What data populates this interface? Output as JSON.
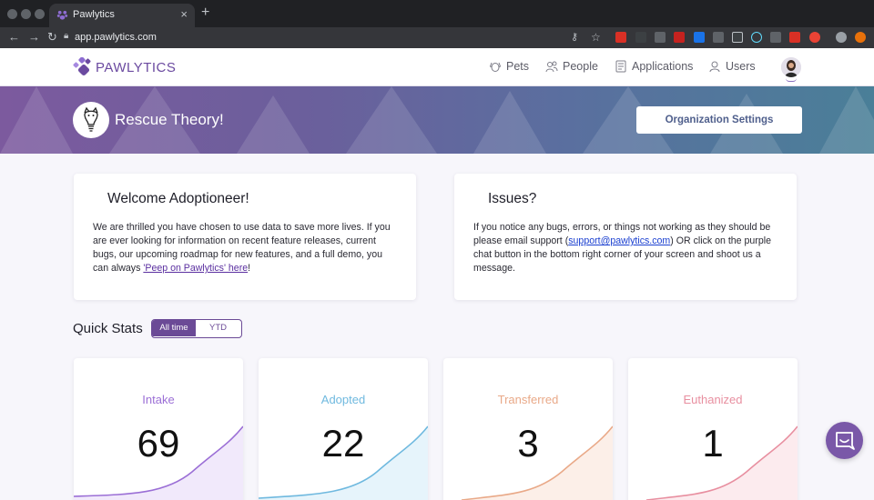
{
  "browser": {
    "tab_title": "Pawlytics",
    "tab_close": "×",
    "new_tab": "+",
    "url": "app.pawlytics.com"
  },
  "header": {
    "logo_text": "PAWLYTICS",
    "nav": [
      {
        "label": "Pets",
        "icon": "dog-face-icon"
      },
      {
        "label": "People",
        "icon": "people-icon"
      },
      {
        "label": "Applications",
        "icon": "document-icon"
      },
      {
        "label": "Users",
        "icon": "user-badge-icon"
      }
    ]
  },
  "banner": {
    "org_name": "Rescue Theory!",
    "settings_button": "Organization Settings"
  },
  "welcome": {
    "title": "Welcome Adoptioneer!",
    "body": "We are thrilled you have chosen to use data to save more lives. If you are ever looking for information on recent feature releases, current bugs, our upcoming roadmap for new features, and a full demo, you can always ",
    "link": "'Peep on Pawlytics' here",
    "tail": "!"
  },
  "issues": {
    "title": "Issues?",
    "body_pre": "If you notice any bugs, errors, or things not working as they should be please email support (",
    "email": "support@pawlytics.com",
    "body_post": ") OR click on the purple chat button in the bottom right corner of your screen and shoot us a message."
  },
  "quick_stats": {
    "title": "Quick Stats",
    "toggle": {
      "active": "All time",
      "inactive": "YTD"
    },
    "cards": [
      {
        "label": "Intake",
        "value": "69",
        "color": "#9b6fd6",
        "fill": "#f1e9fb"
      },
      {
        "label": "Adopted",
        "value": "22",
        "color": "#6fb9df",
        "fill": "#e6f4fb"
      },
      {
        "label": "Transferred",
        "value": "3",
        "color": "#e9a988",
        "fill": "#fcefe8"
      },
      {
        "label": "Euthanized",
        "value": "1",
        "color": "#e88fa0",
        "fill": "#fcebee"
      }
    ]
  },
  "colors": {
    "brand": "#6b4a96",
    "chat_button": "#7a58a8"
  }
}
